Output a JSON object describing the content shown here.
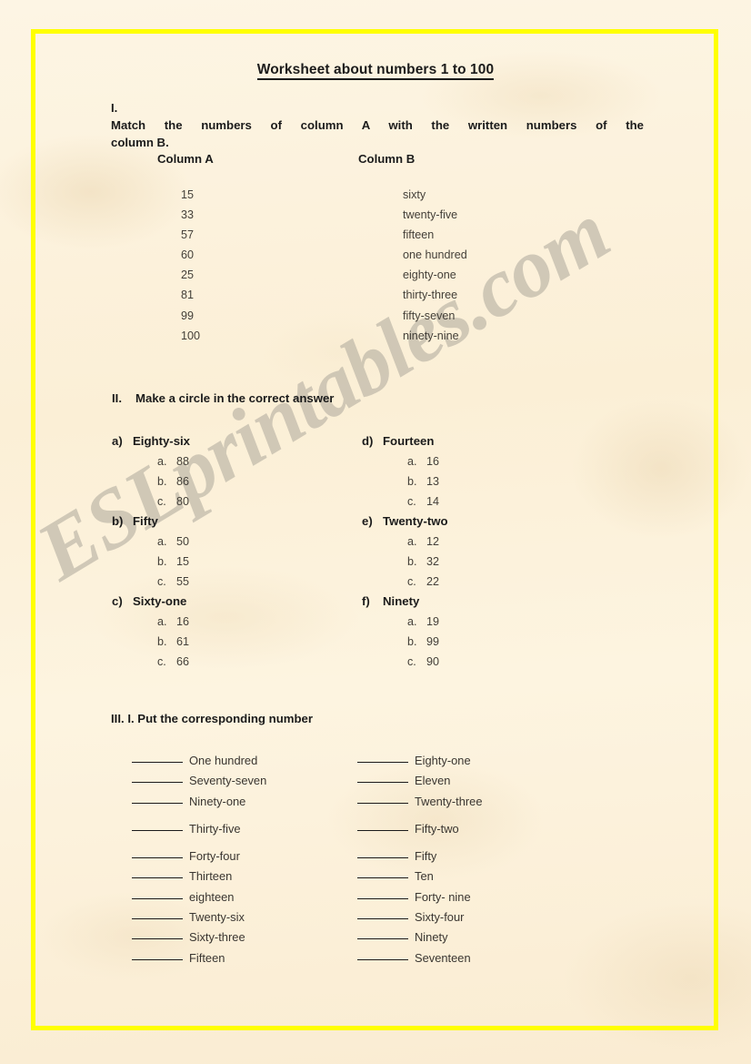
{
  "document": {
    "title": "Worksheet about numbers 1 to 100"
  },
  "watermark": {
    "text": "ESLprintables.com",
    "color": "#b6b0a2"
  },
  "frame": {
    "border_color": "#ffff00"
  },
  "background": {
    "paper_color": "#fcf1da"
  },
  "section1": {
    "roman": "I.",
    "instruction_line1": "Match the numbers of column A with the written numbers of the",
    "instruction_line2": "column B.",
    "column_a_header": "Column A",
    "column_b_header": "Column  B",
    "column_a": [
      "15",
      "33",
      "57",
      "60",
      "25",
      "81",
      "99",
      "100"
    ],
    "column_b": [
      "sixty",
      "twenty-five",
      "fifteen",
      "one hundred",
      "eighty-one",
      "thirty-three",
      "fifty-seven",
      "ninety-nine"
    ]
  },
  "section2": {
    "roman": "II.",
    "instruction": "Make a circle in the correct answer",
    "left_items": [
      {
        "label": "a)",
        "question": "Eighty-six",
        "options": [
          {
            "letter": "a.",
            "value": "88"
          },
          {
            "letter": "b.",
            "value": "86"
          },
          {
            "letter": "c.",
            "value": "80"
          }
        ]
      },
      {
        "label": "b)",
        "question": "Fifty",
        "options": [
          {
            "letter": "a.",
            "value": "50"
          },
          {
            "letter": "b.",
            "value": "15"
          },
          {
            "letter": "c.",
            "value": "55"
          }
        ]
      },
      {
        "label": "c)",
        "question": "Sixty-one",
        "options": [
          {
            "letter": "a.",
            "value": "16"
          },
          {
            "letter": "b.",
            "value": "61"
          },
          {
            "letter": "c.",
            "value": "66"
          }
        ]
      }
    ],
    "right_items": [
      {
        "label": "d)",
        "question": "Fourteen",
        "options": [
          {
            "letter": "a.",
            "value": "16"
          },
          {
            "letter": "b.",
            "value": "13"
          },
          {
            "letter": "c.",
            "value": "14"
          }
        ]
      },
      {
        "label": "e)",
        "question": "Twenty-two",
        "options": [
          {
            "letter": "a.",
            "value": "12"
          },
          {
            "letter": "b.",
            "value": "32"
          },
          {
            "letter": "c.",
            "value": "22"
          }
        ]
      },
      {
        "label": "f)",
        "question": "Ninety",
        "options": [
          {
            "letter": "a.",
            "value": "19"
          },
          {
            "letter": "b.",
            "value": "99"
          },
          {
            "letter": "c.",
            "value": "90"
          }
        ]
      }
    ]
  },
  "section3": {
    "heading": "III. I. Put the corresponding number",
    "left_items": [
      {
        "text": "One hundred",
        "gap_before": false
      },
      {
        "text": "Seventy-seven",
        "gap_before": false
      },
      {
        "text": "Ninety-one",
        "gap_before": false
      },
      {
        "text": "Thirty-five",
        "gap_before": true
      },
      {
        "text": "Forty-four",
        "gap_before": true
      },
      {
        "text": "Thirteen",
        "gap_before": false
      },
      {
        "text": "eighteen",
        "gap_before": false
      },
      {
        "text": "Twenty-six",
        "gap_before": false
      },
      {
        "text": "Sixty-three",
        "gap_before": false
      },
      {
        "text": "Fifteen",
        "gap_before": false
      }
    ],
    "right_items": [
      {
        "text": "Eighty-one",
        "gap_before": false
      },
      {
        "text": "Eleven",
        "gap_before": false
      },
      {
        "text": "Twenty-three",
        "gap_before": false
      },
      {
        "text": "Fifty-two",
        "gap_before": true
      },
      {
        "text": "Fifty",
        "gap_before": true
      },
      {
        "text": "Ten",
        "gap_before": false
      },
      {
        "text": "Forty- nine",
        "gap_before": false
      },
      {
        "text": "Sixty-four",
        "gap_before": false
      },
      {
        "text": "Ninety",
        "gap_before": false
      },
      {
        "text": "Seventeen",
        "gap_before": false
      }
    ]
  }
}
